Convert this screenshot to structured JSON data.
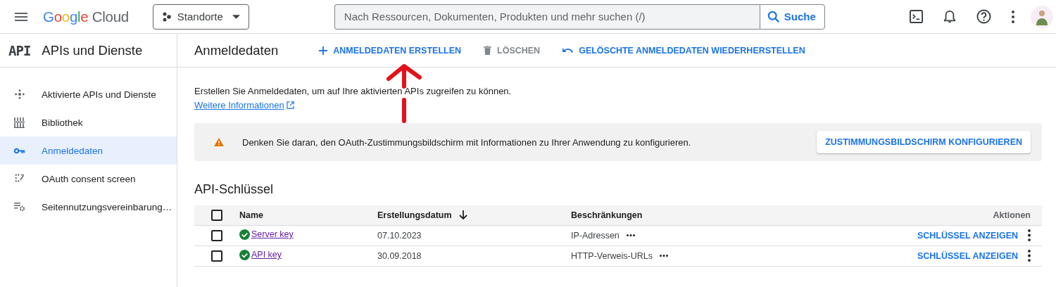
{
  "header": {
    "logo": {
      "brand": "Google",
      "product": "Cloud"
    },
    "project_picker": {
      "label": "Standorte"
    },
    "search": {
      "placeholder": "Nach Ressourcen, Dokumenten, Produkten und mehr suchen (/)",
      "button": "Suche"
    }
  },
  "sidebar": {
    "badge": "API",
    "title": "APIs und Dienste",
    "items": [
      {
        "label": "Aktivierte APIs und Dienste",
        "kind": "apis",
        "selected": false
      },
      {
        "label": "Bibliothek",
        "kind": "library",
        "selected": false
      },
      {
        "label": "Anmeldedaten",
        "kind": "key",
        "selected": true
      },
      {
        "label": "OAuth consent screen",
        "kind": "consent",
        "selected": false
      },
      {
        "label": "Seitennutzungsvereinbarung…",
        "kind": "agreements",
        "selected": false
      }
    ]
  },
  "main": {
    "title": "Anmeldedaten",
    "actions": [
      {
        "label": "ANMELDEDATEN ERSTELLEN",
        "kind": "add",
        "disabled": false
      },
      {
        "label": "LÖSCHEN",
        "kind": "delete",
        "disabled": true
      },
      {
        "label": "GELÖSCHTE ANMELDEDATEN WIEDERHERSTELLEN",
        "kind": "undo",
        "disabled": false
      }
    ],
    "intro": {
      "text": "Erstellen Sie Anmeldedaten, um auf Ihre aktivierten APIs zugreifen zu können.",
      "link": "Weitere Informationen"
    },
    "banner": {
      "text": "Denken Sie daran, den OAuth-Zustimmungsbildschirm mit Informationen zu Ihrer Anwendung zu konfigurieren.",
      "button": "ZUSTIMMUNGSBILDSCHIRM KONFIGURIEREN"
    },
    "section_title": "API-Schlüssel",
    "table": {
      "columns": [
        {
          "label": "Name"
        },
        {
          "label": "Erstellungsdatum",
          "sorted": true
        },
        {
          "label": "Beschränkungen"
        },
        {
          "label": "Aktionen"
        }
      ],
      "header_checked": false,
      "rows": [
        {
          "checked": false,
          "name": "Server key",
          "date": "07.10.2023",
          "restriction": "IP-Adressen",
          "action": "SCHLÜSSEL ANZEIGEN"
        },
        {
          "checked": false,
          "name": "API key",
          "date": "30.09.2018",
          "restriction": "HTTP-Verweis-URLs",
          "action": "SCHLÜSSEL ANZEIGEN"
        }
      ]
    }
  }
}
